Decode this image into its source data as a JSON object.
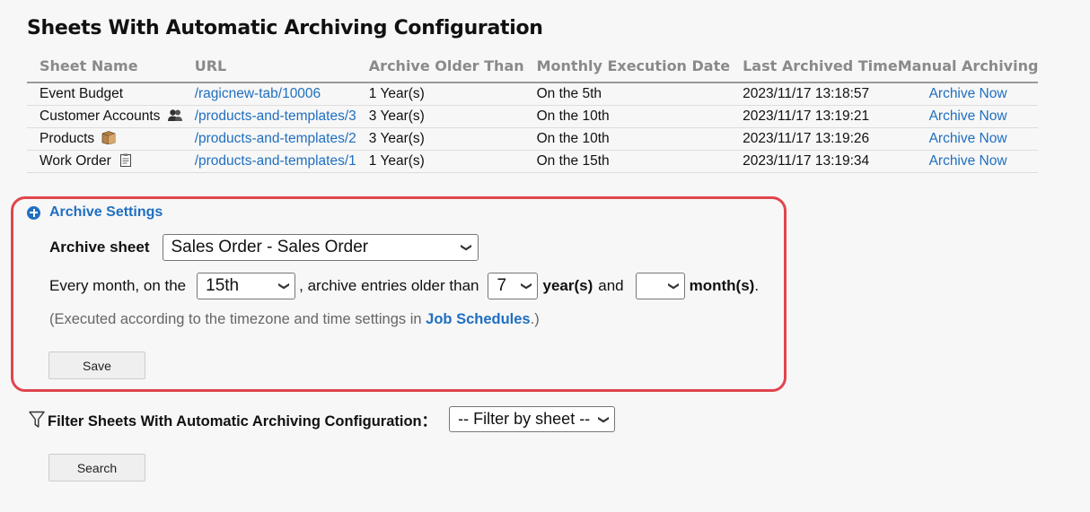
{
  "page": {
    "title": "Sheets With Automatic Archiving Configuration"
  },
  "table": {
    "headers": [
      "Sheet Name",
      "URL",
      "Archive Older Than",
      "Monthly Execution Date",
      "Last Archived Time",
      "Manual Archiving"
    ],
    "rows": [
      {
        "sheet": "Event Budget",
        "icon": "",
        "url": "/ragicnew-tab/10006",
        "older": "1 Year(s)",
        "date": "On the 5th",
        "last": "2023/11/17 13:18:57",
        "action": "Archive Now"
      },
      {
        "sheet": "Customer Accounts",
        "icon": "people-icon",
        "url": "/products-and-templates/3",
        "older": "3 Year(s)",
        "date": "On the 10th",
        "last": "2023/11/17 13:19:21",
        "action": "Archive Now"
      },
      {
        "sheet": "Products",
        "icon": "box-icon",
        "url": "/products-and-templates/2",
        "older": "3 Year(s)",
        "date": "On the 10th",
        "last": "2023/11/17 13:19:26",
        "action": "Archive Now"
      },
      {
        "sheet": "Work Order",
        "icon": "clipboard-icon",
        "url": "/products-and-templates/1",
        "older": "1 Year(s)",
        "date": "On the 15th",
        "last": "2023/11/17 13:19:34",
        "action": "Archive Now"
      }
    ]
  },
  "settings": {
    "title": "Archive Settings",
    "archive_sheet_label": "Archive sheet",
    "archive_sheet_value": "Sales Order - Sales Order",
    "every_month_label": "Every month, on the",
    "day_value": "15th",
    "older_than_label": ", archive entries older than",
    "years_value": "7",
    "years_label": "year(s)",
    "and_label": "and",
    "months_value": "",
    "months_label": "month(s)",
    "period": ".",
    "note_prefix": "(Executed according to the timezone and time settings in ",
    "note_link": "Job Schedules",
    "note_suffix": ".)",
    "save_label": "Save"
  },
  "filter": {
    "label": "Filter Sheets With Automatic Archiving Configuration：",
    "select_value": "-- Filter by sheet --",
    "search_label": "Search"
  },
  "colors": {
    "link": "#1f6fc1",
    "highlight_border": "#e0454d"
  }
}
